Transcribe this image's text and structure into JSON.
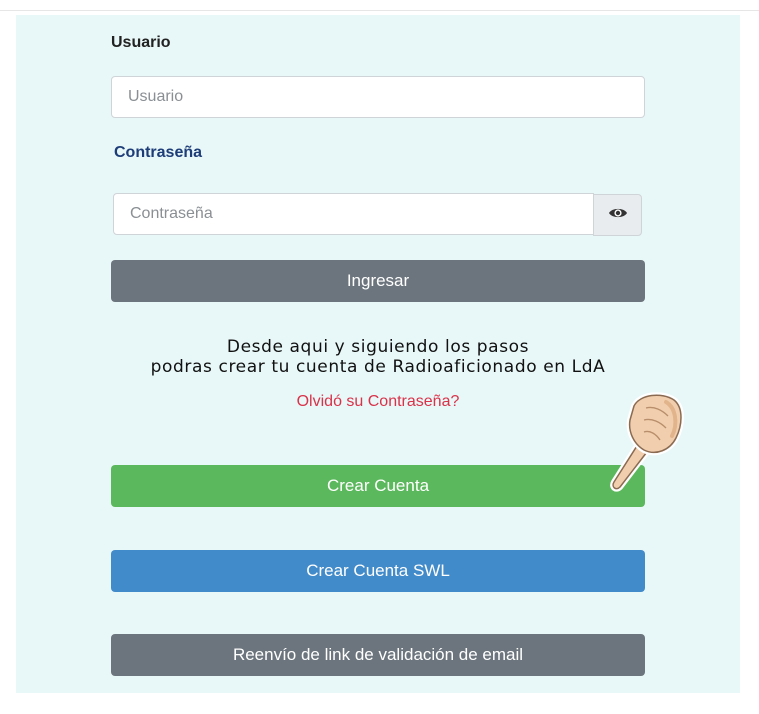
{
  "form": {
    "user_label": "Usuario",
    "user_placeholder": "Usuario",
    "password_label": "Contraseña",
    "password_placeholder": "Contraseña",
    "login_button": "Ingresar",
    "info_line1": "Desde aqui y siguiendo los pasos",
    "info_line2": "podras crear tu cuenta de Radioaficionado en LdA",
    "forgot_link": "Olvidó su Contraseña?",
    "create_account_button": "Crear Cuenta",
    "create_swl_button": "Crear Cuenta SWL",
    "resend_button": "Reenvío de link de validación de email"
  },
  "icons": {
    "password_toggle": "eye-icon",
    "pointer": "pointing-hand-icon"
  },
  "colors": {
    "panel_bg": "#e8f7f7",
    "gray_button": "#6c757d",
    "green_button": "#5cb85c",
    "blue_button": "#428bca",
    "link_red": "#d9334a",
    "password_label": "#1d3d78"
  }
}
